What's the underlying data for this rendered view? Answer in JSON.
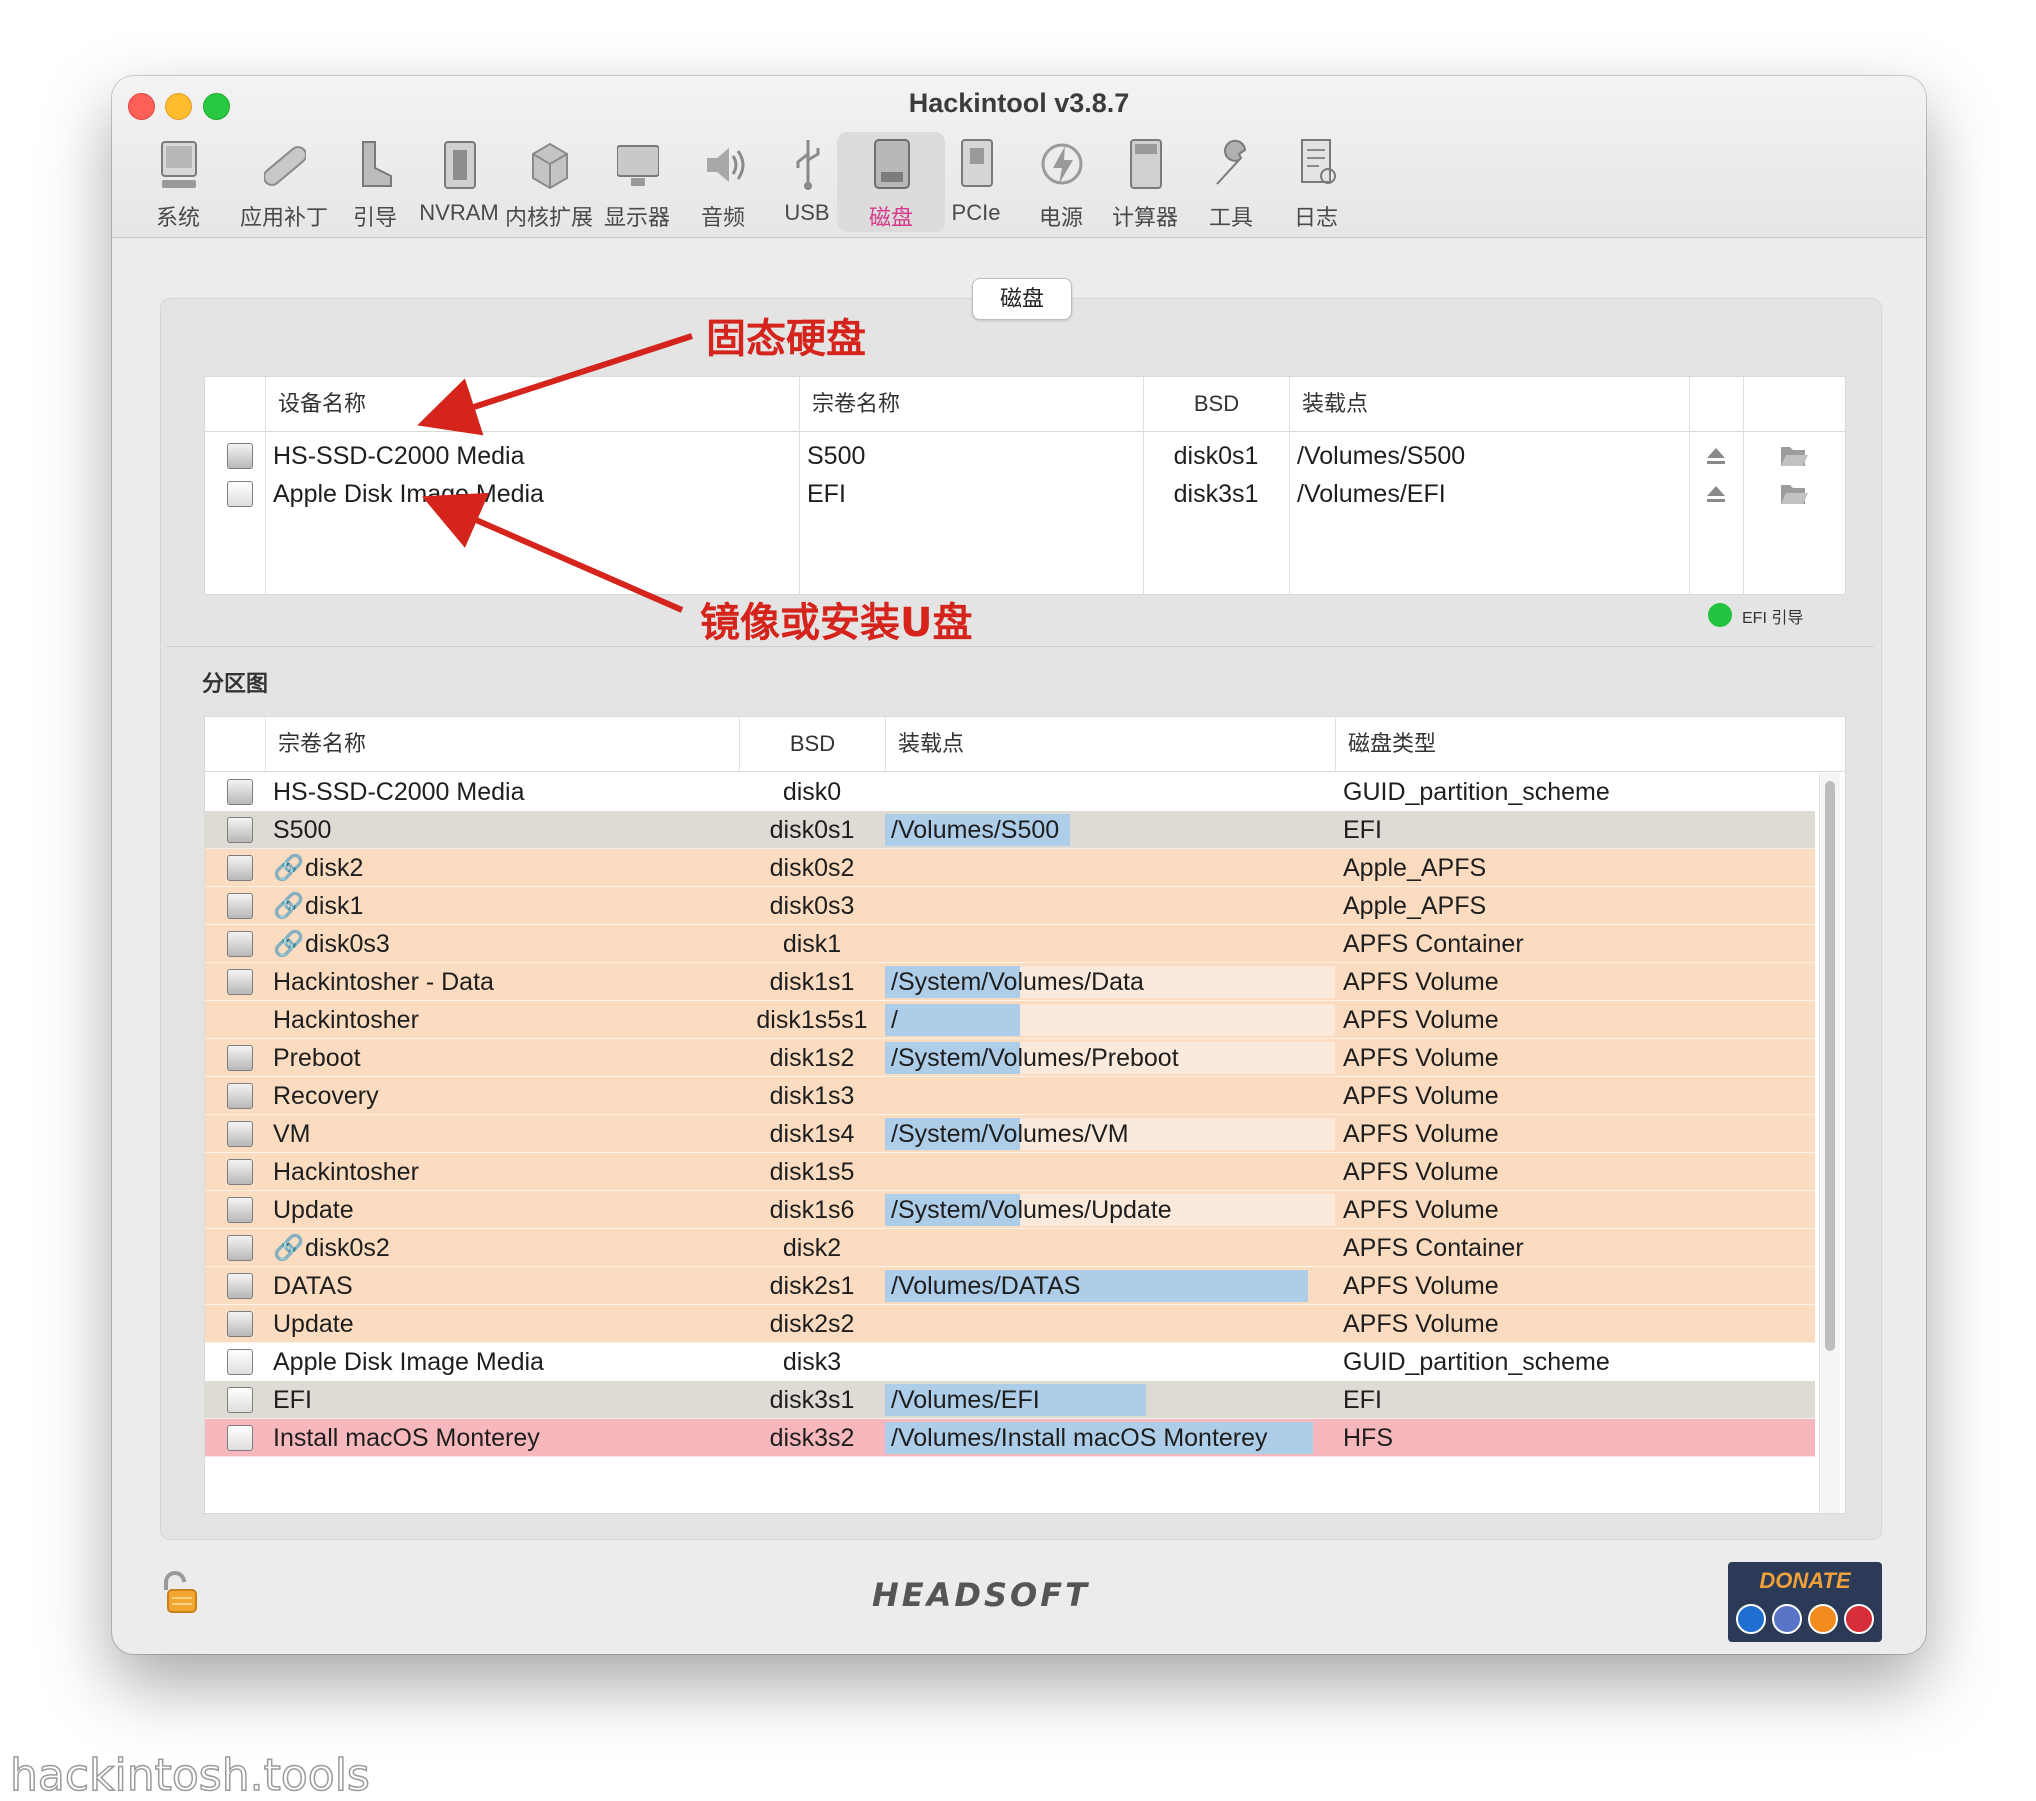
{
  "window": {
    "title": "Hackintool v3.8.7"
  },
  "toolbar": {
    "items": [
      {
        "label": "系统",
        "icon": "computer-icon"
      },
      {
        "label": "应用补丁",
        "icon": "bandage-icon"
      },
      {
        "label": "引导",
        "icon": "boot-icon"
      },
      {
        "label": "NVRAM",
        "icon": "nvram-chip-icon"
      },
      {
        "label": "内核扩展",
        "icon": "kext-box-icon"
      },
      {
        "label": "显示器",
        "icon": "display-icon"
      },
      {
        "label": "音频",
        "icon": "speaker-icon"
      },
      {
        "label": "USB",
        "icon": "usb-icon"
      },
      {
        "label": "磁盘",
        "icon": "disk-icon"
      },
      {
        "label": "PCIe",
        "icon": "pcie-card-icon"
      },
      {
        "label": "电源",
        "icon": "power-bolt-icon"
      },
      {
        "label": "计算器",
        "icon": "calculator-icon"
      },
      {
        "label": "工具",
        "icon": "wrench-icon"
      },
      {
        "label": "日志",
        "icon": "log-document-icon"
      }
    ],
    "active_index": 8,
    "active_color": "#d83a8d"
  },
  "tab": {
    "label": "磁盘"
  },
  "devices": {
    "headers": {
      "device_name": "设备名称",
      "volume_name": "宗卷名称",
      "bsd": "BSD",
      "mount_point": "装载点"
    },
    "rows": [
      {
        "device": "HS-SSD-C2000 Media",
        "volume": "S500",
        "bsd": "disk0s1",
        "mount": "/Volumes/S500"
      },
      {
        "device": "Apple Disk Image Media",
        "volume": "EFI",
        "bsd": "disk3s1",
        "mount": "/Volumes/EFI"
      }
    ]
  },
  "legend": {
    "efi_boot": "EFI 引导",
    "efi_color": "#22c440"
  },
  "annotations": {
    "ssd": "固态硬盘",
    "image_usb": "镜像或安装U盘",
    "arrow_color": "#d4241c"
  },
  "partitions": {
    "title": "分区图",
    "headers": {
      "volume_name": "宗卷名称",
      "bsd": "BSD",
      "mount_point": "装载点",
      "disk_type": "磁盘类型"
    },
    "rows": [
      {
        "name": "HS-SSD-C2000 Media",
        "bsd": "disk0",
        "mount": "",
        "type": "GUID_partition_scheme",
        "style": "white",
        "icon": "gray",
        "link": false,
        "mount_fill": 0
      },
      {
        "name": "S500",
        "bsd": "disk0s1",
        "mount": "/Volumes/S500",
        "type": "EFI",
        "style": "gray",
        "icon": "gray",
        "link": false,
        "mount_fill": 0.41
      },
      {
        "name": "disk2",
        "bsd": "disk0s2",
        "mount": "",
        "type": "Apple_APFS",
        "style": "orange",
        "icon": "gray",
        "link": true,
        "mount_fill": 0
      },
      {
        "name": "disk1",
        "bsd": "disk0s3",
        "mount": "",
        "type": "Apple_APFS",
        "style": "orange",
        "icon": "gray",
        "link": true,
        "mount_fill": 0
      },
      {
        "name": "disk0s3",
        "bsd": "disk1",
        "mount": "",
        "type": "APFS Container",
        "style": "orange",
        "icon": "gray",
        "link": true,
        "mount_fill": 0
      },
      {
        "name": "Hackintosher - Data",
        "bsd": "disk1s1",
        "mount": "/System/Volumes/Data",
        "type": "APFS Volume",
        "style": "orange",
        "icon": "gray",
        "link": false,
        "mount_fill": 0.3,
        "mount_bg": true
      },
      {
        "name": "Hackintosher",
        "bsd": "disk1s5s1",
        "mount": "/",
        "type": "APFS Volume",
        "style": "orange",
        "icon": "none",
        "link": false,
        "mount_fill": 0.3,
        "mount_bg": true
      },
      {
        "name": "Preboot",
        "bsd": "disk1s2",
        "mount": "/System/Volumes/Preboot",
        "type": "APFS Volume",
        "style": "orange",
        "icon": "gray",
        "link": false,
        "mount_fill": 0.3,
        "mount_bg": true
      },
      {
        "name": "Recovery",
        "bsd": "disk1s3",
        "mount": "",
        "type": "APFS Volume",
        "style": "orange",
        "icon": "gray",
        "link": false,
        "mount_fill": 0
      },
      {
        "name": "VM",
        "bsd": "disk1s4",
        "mount": "/System/Volumes/VM",
        "type": "APFS Volume",
        "style": "orange",
        "icon": "gray",
        "link": false,
        "mount_fill": 0.3,
        "mount_bg": true
      },
      {
        "name": "Hackintosher",
        "bsd": "disk1s5",
        "mount": "",
        "type": "APFS Volume",
        "style": "orange",
        "icon": "gray",
        "link": false,
        "mount_fill": 0
      },
      {
        "name": "Update",
        "bsd": "disk1s6",
        "mount": "/System/Volumes/Update",
        "type": "APFS Volume",
        "style": "orange",
        "icon": "gray",
        "link": false,
        "mount_fill": 0.3,
        "mount_bg": true
      },
      {
        "name": "disk0s2",
        "bsd": "disk2",
        "mount": "",
        "type": "APFS Container",
        "style": "orange",
        "icon": "gray",
        "link": true,
        "mount_fill": 0
      },
      {
        "name": "DATAS",
        "bsd": "disk2s1",
        "mount": "/Volumes/DATAS",
        "type": "APFS Volume",
        "style": "orange",
        "icon": "gray",
        "link": false,
        "mount_fill": 0.94
      },
      {
        "name": "Update",
        "bsd": "disk2s2",
        "mount": "",
        "type": "APFS Volume",
        "style": "orange",
        "icon": "gray",
        "link": false,
        "mount_fill": 0
      },
      {
        "name": "Apple Disk Image Media",
        "bsd": "disk3",
        "mount": "",
        "type": "GUID_partition_scheme",
        "style": "white",
        "icon": "white",
        "link": false,
        "mount_fill": 0
      },
      {
        "name": "EFI",
        "bsd": "disk3s1",
        "mount": "/Volumes/EFI",
        "type": "EFI",
        "style": "gray",
        "icon": "white",
        "link": false,
        "mount_fill": 0.58
      },
      {
        "name": "Install macOS Monterey",
        "bsd": "disk3s2",
        "mount": "/Volumes/Install macOS Monterey",
        "type": "HFS",
        "style": "pink",
        "icon": "white",
        "link": false,
        "mount_fill": 0.95
      }
    ]
  },
  "footer": {
    "brand": "HEADSOFT",
    "donate": "DONATE"
  },
  "watermark": "hackintosh.tools"
}
